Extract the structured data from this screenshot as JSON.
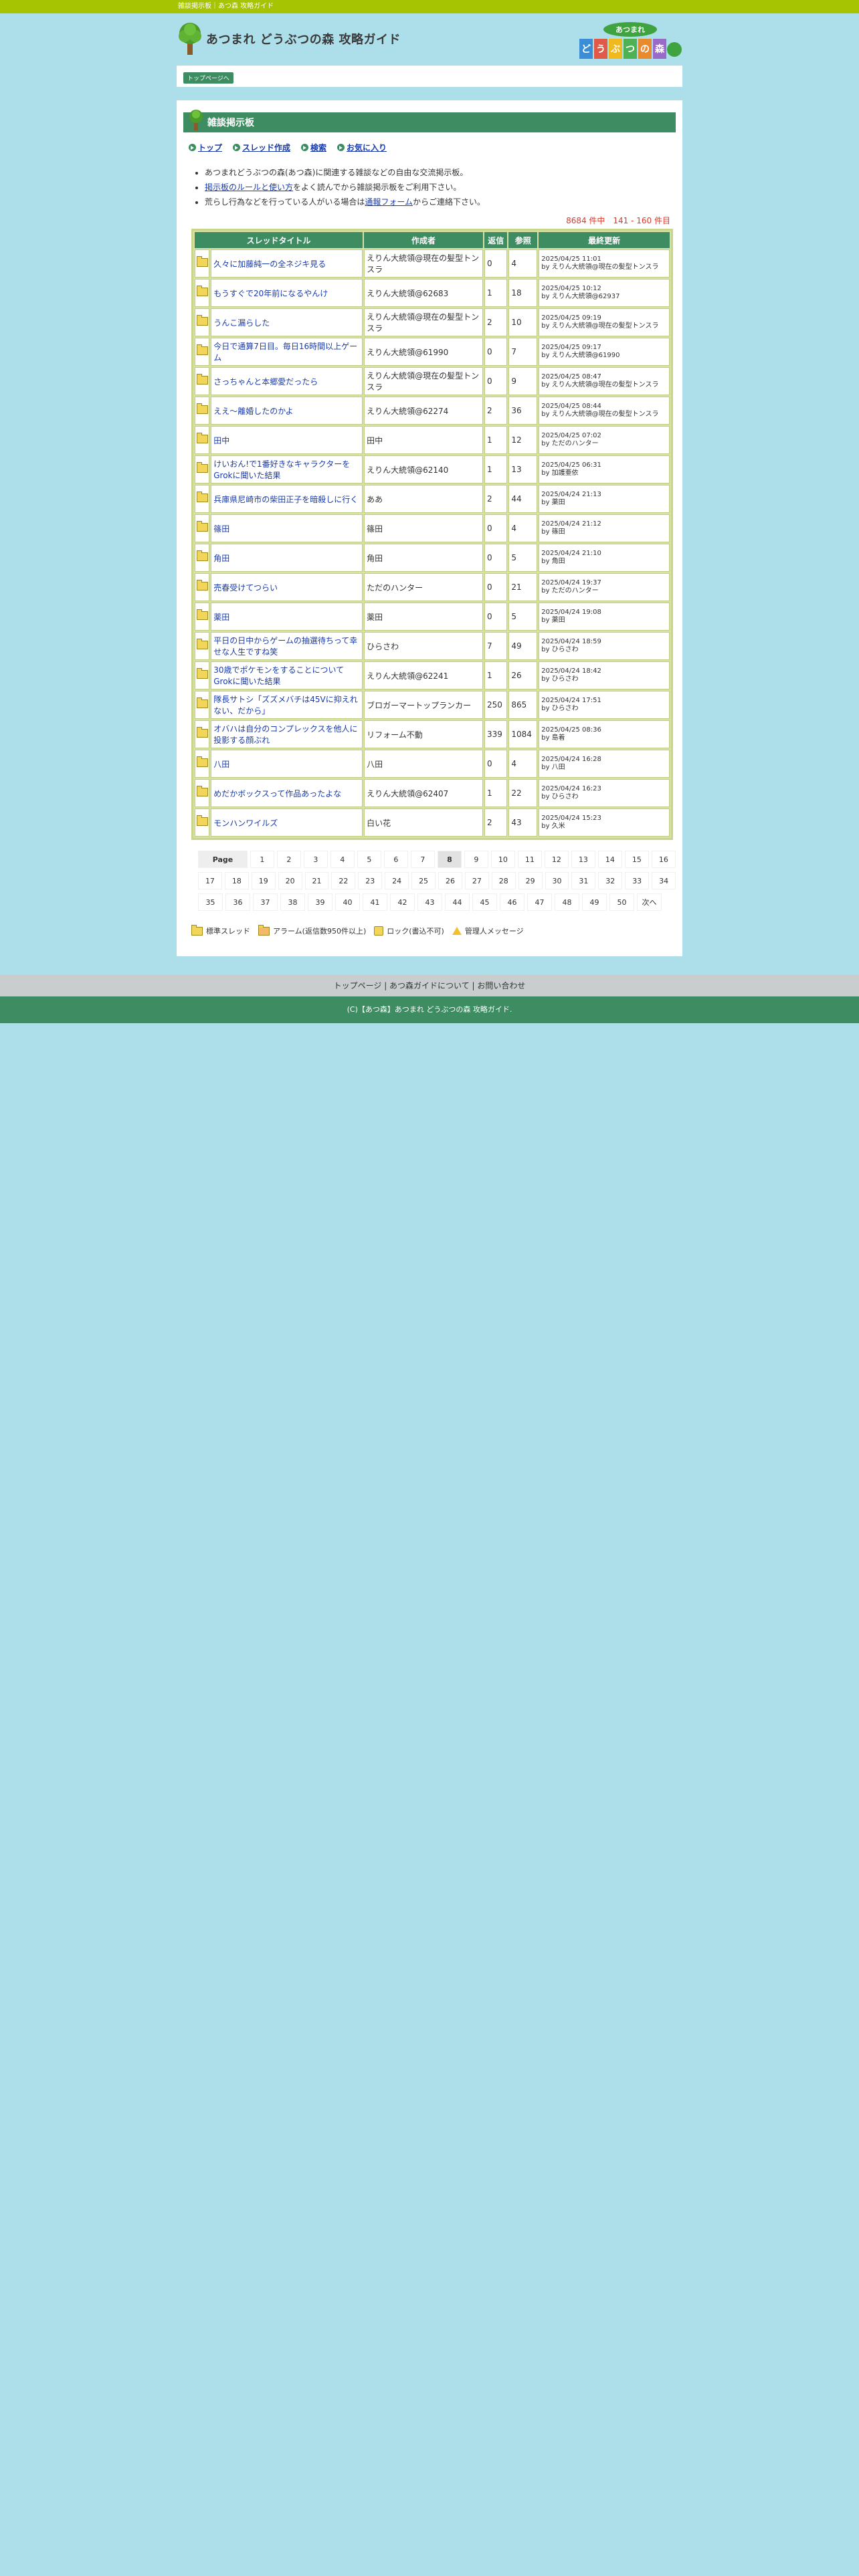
{
  "topbar": {
    "text": "雑談掲示板｜あつ森 攻略ガイド"
  },
  "header": {
    "site_title": "あつまれ どうぶつの森 攻略ガイド",
    "game_logo": [
      "あつまれ",
      "ど",
      "う",
      "ぶ",
      "つ",
      "の",
      "森"
    ]
  },
  "breadcrumb": {
    "top_button": "トップページへ"
  },
  "board": {
    "title": "雑談掲示板",
    "nav": [
      "トップ",
      "スレッド作成",
      "検索",
      "お気に入り"
    ],
    "notes": [
      {
        "text": "あつまれどうぶつの森(あつ森)に関連する雑談などの自由な交流掲示板。"
      },
      {
        "pre": "",
        "link": "掲示板のルールと使い方",
        "post": "をよく読んでから雑談掲示板をご利用下さい。"
      },
      {
        "pre": "荒らし行為などを行っている人がいる場合は",
        "link": "通報フォーム",
        "post": "からご連絡下さい。"
      }
    ],
    "count_text": "8684 件中　141 - 160 件目"
  },
  "table": {
    "headers": [
      "スレッドタイトル",
      "作成者",
      "返信",
      "参照",
      "最終更新"
    ],
    "rows": [
      {
        "title": "久々に加藤純一の全ネジキ見る",
        "author": "えりん大統領@現在の髪型トンスラ",
        "replies": "0",
        "views": "4",
        "updated": "2025/04/25 11:01",
        "by": "by えりん大統領@現在の髪型トンスラ"
      },
      {
        "title": "もうすぐで20年前になるやんけ",
        "author": "えりん大統領@62683",
        "replies": "1",
        "views": "18",
        "updated": "2025/04/25 10:12",
        "by": "by えりん大統領@62937"
      },
      {
        "title": "うんこ漏らした",
        "author": "えりん大統領@現在の髪型トンスラ",
        "replies": "2",
        "views": "10",
        "updated": "2025/04/25 09:19",
        "by": "by えりん大統領@現在の髪型トンスラ"
      },
      {
        "title": "今日で通算7日目。毎日16時間以上ゲーム",
        "author": "えりん大統領@61990",
        "replies": "0",
        "views": "7",
        "updated": "2025/04/25 09:17",
        "by": "by えりん大統領@61990"
      },
      {
        "title": "さっちゃんと本郷愛だったら",
        "author": "えりん大統領@現在の髪型トンスラ",
        "replies": "0",
        "views": "9",
        "updated": "2025/04/25 08:47",
        "by": "by えりん大統領@現在の髪型トンスラ"
      },
      {
        "title": "ええ～離婚したのかよ",
        "author": "えりん大統領@62274",
        "replies": "2",
        "views": "36",
        "updated": "2025/04/25 08:44",
        "by": "by えりん大統領@現在の髪型トンスラ"
      },
      {
        "title": "田中",
        "author": "田中",
        "replies": "1",
        "views": "12",
        "updated": "2025/04/25 07:02",
        "by": "by ただのハンター"
      },
      {
        "title": "けいおん!で1番好きなキャラクターをGrokに聞いた結果",
        "author": "えりん大統領@62140",
        "replies": "1",
        "views": "13",
        "updated": "2025/04/25 06:31",
        "by": "by 加護亜依"
      },
      {
        "title": "兵庫県尼崎市の柴田正子を暗殺しに行く",
        "author": "ああ",
        "replies": "2",
        "views": "44",
        "updated": "2025/04/24 21:13",
        "by": "by 薬田"
      },
      {
        "title": "篠田",
        "author": "篠田",
        "replies": "0",
        "views": "4",
        "updated": "2025/04/24 21:12",
        "by": "by 篠田"
      },
      {
        "title": "角田",
        "author": "角田",
        "replies": "0",
        "views": "5",
        "updated": "2025/04/24 21:10",
        "by": "by 角田"
      },
      {
        "title": "売春受けてつらい",
        "author": "ただのハンター",
        "replies": "0",
        "views": "21",
        "updated": "2025/04/24 19:37",
        "by": "by ただのハンター"
      },
      {
        "title": "薬田",
        "author": "薬田",
        "replies": "0",
        "views": "5",
        "updated": "2025/04/24 19:08",
        "by": "by 薬田"
      },
      {
        "title": "平日の日中からゲームの抽選待ちって幸せな人生ですね笑",
        "author": "ひらさわ",
        "replies": "7",
        "views": "49",
        "updated": "2025/04/24 18:59",
        "by": "by ひらさわ"
      },
      {
        "title": "30歳でポケモンをすることについてGrokに聞いた結果",
        "author": "えりん大統領@62241",
        "replies": "1",
        "views": "26",
        "updated": "2025/04/24 18:42",
        "by": "by ひらさわ"
      },
      {
        "title": "隊長サトシ「ズズメバチは45Ⅴに抑えれない、だから」",
        "author": "ブロガーマートップランカー",
        "replies": "250",
        "views": "865",
        "updated": "2025/04/24 17:51",
        "by": "by ひらさわ"
      },
      {
        "title": "オバハは自分のコンプレックスを他人に投影する顔ぶれ",
        "author": "リフォーム不動",
        "replies": "339",
        "views": "1084",
        "updated": "2025/04/25 08:36",
        "by": "by 島着"
      },
      {
        "title": "八田",
        "author": "八田",
        "replies": "0",
        "views": "4",
        "updated": "2025/04/24 16:28",
        "by": "by 八田"
      },
      {
        "title": "めだかボックスって作品あったよな",
        "author": "えりん大統領@62407",
        "replies": "1",
        "views": "22",
        "updated": "2025/04/24 16:23",
        "by": "by ひらさわ"
      },
      {
        "title": "モンハンワイルズ",
        "author": "白い花",
        "replies": "2",
        "views": "43",
        "updated": "2025/04/24 15:23",
        "by": "by 久米"
      }
    ]
  },
  "pager": {
    "label": "Page",
    "current": "8",
    "rows": [
      [
        "1",
        "2",
        "3",
        "4",
        "5",
        "6",
        "7",
        "8",
        "9",
        "10",
        "11",
        "12",
        "13",
        "14",
        "15",
        "16"
      ],
      [
        "17",
        "18",
        "19",
        "20",
        "21",
        "22",
        "23",
        "24",
        "25",
        "26",
        "27",
        "28",
        "29",
        "30",
        "31",
        "32",
        "33",
        "34"
      ],
      [
        "35",
        "36",
        "37",
        "38",
        "39",
        "40",
        "41",
        "42",
        "43",
        "44",
        "45",
        "46",
        "47",
        "48",
        "49",
        "50",
        "次へ"
      ]
    ]
  },
  "legend": [
    "標準スレッド",
    "アラーム(返信数950件以上)",
    "ロック(書込不可)",
    "管理人メッセージ"
  ],
  "footer": {
    "links": [
      "トップページ",
      "あつ森ガイドについて",
      "お問い合わせ"
    ],
    "copyright": "(C)【あつ森】あつまれ どうぶつの森 攻略ガイド."
  },
  "colors": {
    "topbar": "#a6c402",
    "background": "#addfeb",
    "accent_green": "#3d8c62",
    "link": "#1a3ba8",
    "count_red": "#d63a2e"
  }
}
